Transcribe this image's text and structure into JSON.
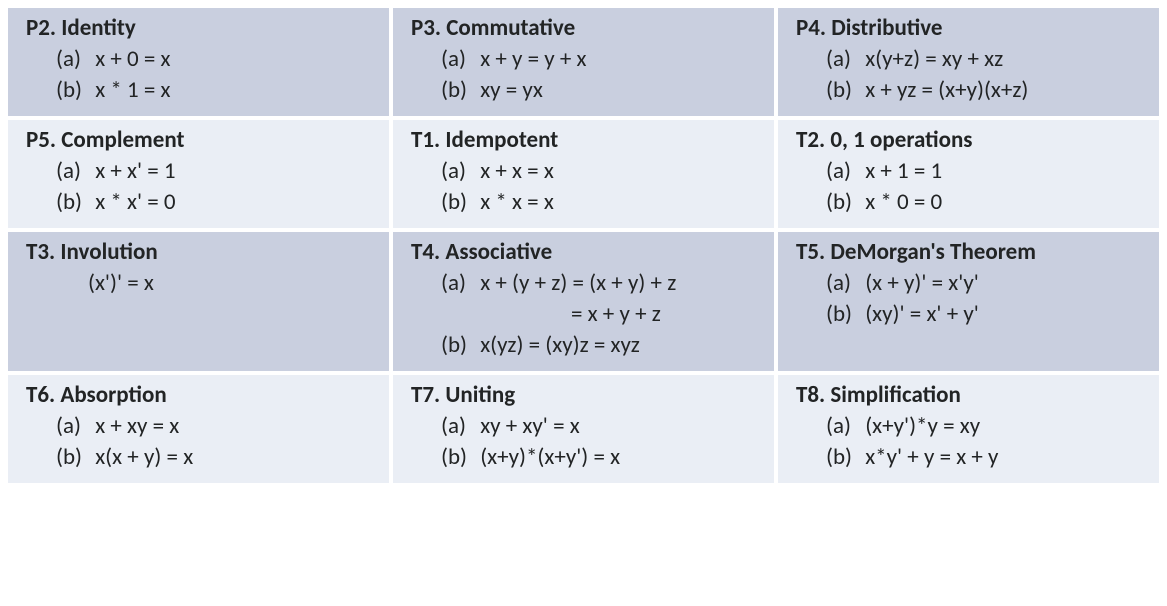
{
  "rows": [
    {
      "style": "row-a",
      "cells": [
        {
          "id": "P2",
          "title": "P2. Identity",
          "lines": [
            {
              "label": "(a)",
              "text": "x + 0 = x"
            },
            {
              "label": "(b)",
              "text": "x * 1 = x"
            }
          ]
        },
        {
          "id": "P3",
          "title": "P3. Commutative",
          "lines": [
            {
              "label": "(a)",
              "text": "x + y = y + x"
            },
            {
              "label": "(b)",
              "text": "xy = yx"
            }
          ]
        },
        {
          "id": "P4",
          "title": "P4. Distributive",
          "lines": [
            {
              "label": "(a)",
              "text": "x(y+z) = xy + xz"
            },
            {
              "label": "(b)",
              "text": "x + yz = (x+y)(x+z)"
            }
          ]
        }
      ]
    },
    {
      "style": "row-b",
      "cells": [
        {
          "id": "P5",
          "title": "P5. Complement",
          "lines": [
            {
              "label": "(a)",
              "text": "x + x' = 1"
            },
            {
              "label": "(b)",
              "text": "x * x' = 0"
            }
          ]
        },
        {
          "id": "T1",
          "title": "T1. Idempotent",
          "lines": [
            {
              "label": "(a)",
              "text": "x + x = x"
            },
            {
              "label": "(b)",
              "text": "x * x = x"
            }
          ]
        },
        {
          "id": "T2",
          "title": "T2. 0, 1 operations",
          "lines": [
            {
              "label": "(a)",
              "text": "x + 1 = 1"
            },
            {
              "label": "(b)",
              "text": "x * 0 = 0"
            }
          ]
        }
      ]
    },
    {
      "style": "row-a",
      "cells": [
        {
          "id": "T3",
          "title": "T3. Involution",
          "lines": [
            {
              "single": true,
              "text": "(x')' = x"
            }
          ]
        },
        {
          "id": "T4",
          "title": "T4. Associative",
          "lines": [
            {
              "label": "(a)",
              "text": "x + (y + z) = (x + y) + z"
            },
            {
              "cont": true,
              "text": "                         = x + y + z"
            },
            {
              "label": "(b)",
              "text": "x(yz) = (xy)z = xyz"
            }
          ]
        },
        {
          "id": "T5",
          "title": "T5. DeMorgan's Theorem",
          "lines": [
            {
              "label": "(a)",
              "text": "(x + y)' = x'y'"
            },
            {
              "label": "(b)",
              "text": "(xy)' = x' + y'"
            }
          ]
        }
      ]
    },
    {
      "style": "row-b",
      "cells": [
        {
          "id": "T6",
          "title": "T6. Absorption",
          "lines": [
            {
              "label": "(a)",
              "text": "x + xy = x"
            },
            {
              "label": "(b)",
              "text": "x(x + y) = x"
            }
          ]
        },
        {
          "id": "T7",
          "title": "T7. Uniting",
          "lines": [
            {
              "label": "(a)",
              "text": "xy + xy' = x"
            },
            {
              "label": "(b)",
              "text": "(x+y)*(x+y') = x"
            }
          ]
        },
        {
          "id": "T8",
          "title": "T8. Simplification",
          "lines": [
            {
              "label": "(a)",
              "text": "(x+y')*y = xy"
            },
            {
              "label": "(b)",
              "text": "x*y' + y = x + y"
            }
          ]
        }
      ]
    }
  ]
}
